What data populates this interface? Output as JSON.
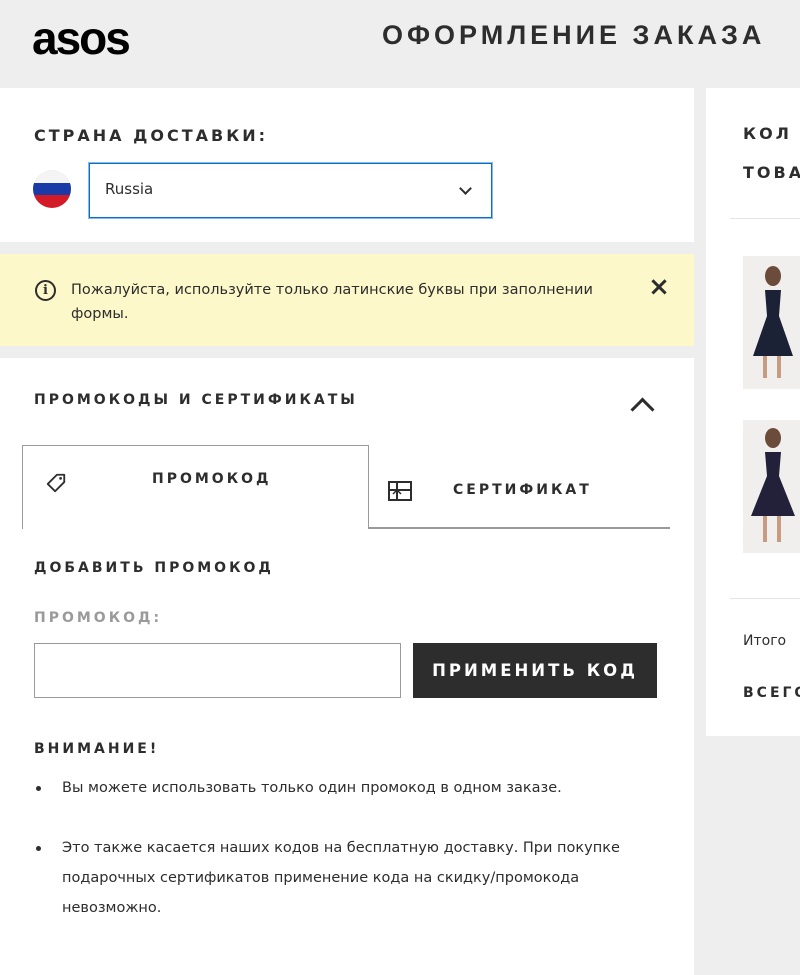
{
  "header": {
    "logo": "asos",
    "title": "ОФОРМЛЕНИЕ ЗАКАЗА"
  },
  "country": {
    "title": "СТРАНА ДОСТАВКИ:",
    "selected": "Russia"
  },
  "notice": {
    "text": "Пожалуйста, используйте только латинские буквы при заполнении формы.",
    "close_icon": "×"
  },
  "promo": {
    "title": "ПРОМОКОДЫ И СЕРТИФИКАТЫ",
    "tabs": [
      {
        "label": "ПРОМОКОД",
        "icon": "tag-icon"
      },
      {
        "label": "СЕРТИФИКАТ",
        "icon": "gift-card-icon"
      }
    ],
    "add_title": "ДОБАВИТЬ ПРОМОКОД",
    "field_label": "ПРОМОКОД:",
    "input_value": "",
    "apply_label": "ПРИМЕНИТЬ КОД",
    "attention_title": "ВНИМАНИЕ!",
    "notes": [
      "Вы можете использовать только один промокод в одном заказе.",
      "Это также касается наших кодов на бесплатную доставку. При покупке подарочных сертификатов применение кода на скидку/промокода невозможно."
    ]
  },
  "summary": {
    "title_line1": "КОЛ",
    "title_line2": "ТОВА",
    "subtotal_label": "Итого",
    "total_label": "ВСЕГО"
  },
  "colors": {
    "accent_blue": "#0770cf",
    "notice_bg": "#fcf8c9",
    "dark": "#2d2d2d"
  }
}
